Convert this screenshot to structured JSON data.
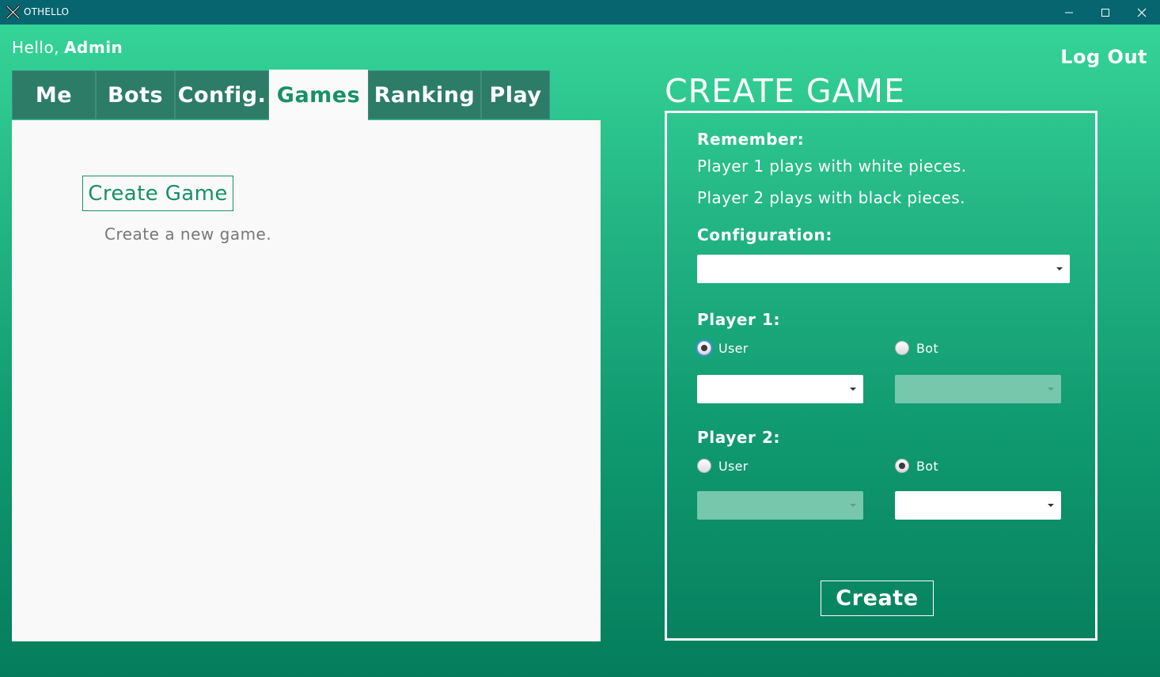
{
  "window": {
    "title": "OTHELLO",
    "title_bar_color": "#06656f"
  },
  "header": {
    "greeting": "Hello,",
    "username": "Admin",
    "logout_label": "Log Out"
  },
  "tabs": [
    {
      "label": "Me",
      "active": false
    },
    {
      "label": "Bots",
      "active": false
    },
    {
      "label": "Config.",
      "active": false
    },
    {
      "label": "Games",
      "active": true
    },
    {
      "label": "Ranking",
      "active": false
    },
    {
      "label": "Play",
      "active": false
    }
  ],
  "games_panel": {
    "create_button_label": "Create Game",
    "create_description": "Create a new game."
  },
  "create_form": {
    "title": "CREATE GAME",
    "remember_label": "Remember:",
    "remember_lines": [
      "Player 1 plays with white pieces.",
      "Player 2 plays with black pieces."
    ],
    "configuration_label": "Configuration:",
    "configuration_value": "",
    "player1": {
      "label": "Player 1:",
      "user_option": "User",
      "bot_option": "Bot",
      "selected": "User",
      "user_select_value": "",
      "bot_select_value": ""
    },
    "player2": {
      "label": "Player 2:",
      "user_option": "User",
      "bot_option": "Bot",
      "selected": "Bot",
      "user_select_value": "",
      "bot_select_value": ""
    },
    "submit_label": "Create"
  },
  "colors": {
    "accent": "#179068",
    "tab_inactive": "#2d7c68",
    "background_top": "#35d498",
    "background_bottom": "#057d5c"
  }
}
